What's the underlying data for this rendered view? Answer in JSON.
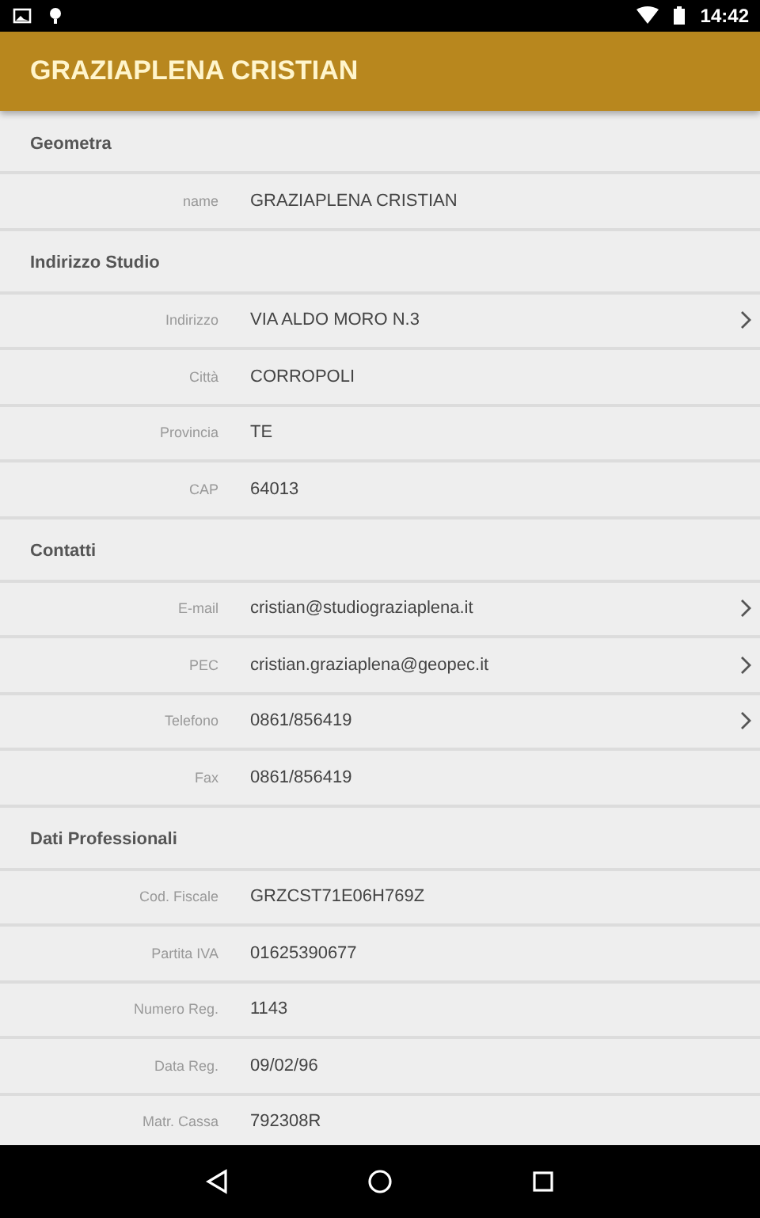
{
  "status_bar": {
    "time": "14:42"
  },
  "app_bar": {
    "title": "GRAZIAPLENA CRISTIAN"
  },
  "sections": [
    {
      "title": "Geometra",
      "rows": [
        {
          "label": "name",
          "value": "GRAZIAPLENA CRISTIAN",
          "arrow": false
        }
      ]
    },
    {
      "title": "Indirizzo Studio",
      "rows": [
        {
          "label": "Indirizzo",
          "value": "VIA ALDO MORO N.3",
          "arrow": true
        },
        {
          "label": "Città",
          "value": "CORROPOLI",
          "arrow": false
        },
        {
          "label": "Provincia",
          "value": "TE",
          "arrow": false
        },
        {
          "label": "CAP",
          "value": "64013",
          "arrow": false
        }
      ]
    },
    {
      "title": "Contatti",
      "rows": [
        {
          "label": "E-mail",
          "value": "cristian@studiograziaplena.it",
          "arrow": true
        },
        {
          "label": "PEC",
          "value": "cristian.graziaplena@geopec.it",
          "arrow": true
        },
        {
          "label": "Telefono",
          "value": "0861/856419",
          "arrow": true
        },
        {
          "label": "Fax",
          "value": "0861/856419",
          "arrow": false
        }
      ]
    },
    {
      "title": "Dati Professionali",
      "rows": [
        {
          "label": "Cod. Fiscale",
          "value": "GRZCST71E06H769Z",
          "arrow": false
        },
        {
          "label": "Partita IVA",
          "value": "01625390677",
          "arrow": false
        },
        {
          "label": "Numero Reg.",
          "value": "1143",
          "arrow": false
        },
        {
          "label": "Data Reg.",
          "value": "09/02/96",
          "arrow": false
        },
        {
          "label": "Matr. Cassa",
          "value": "792308R",
          "arrow": false
        }
      ]
    }
  ]
}
